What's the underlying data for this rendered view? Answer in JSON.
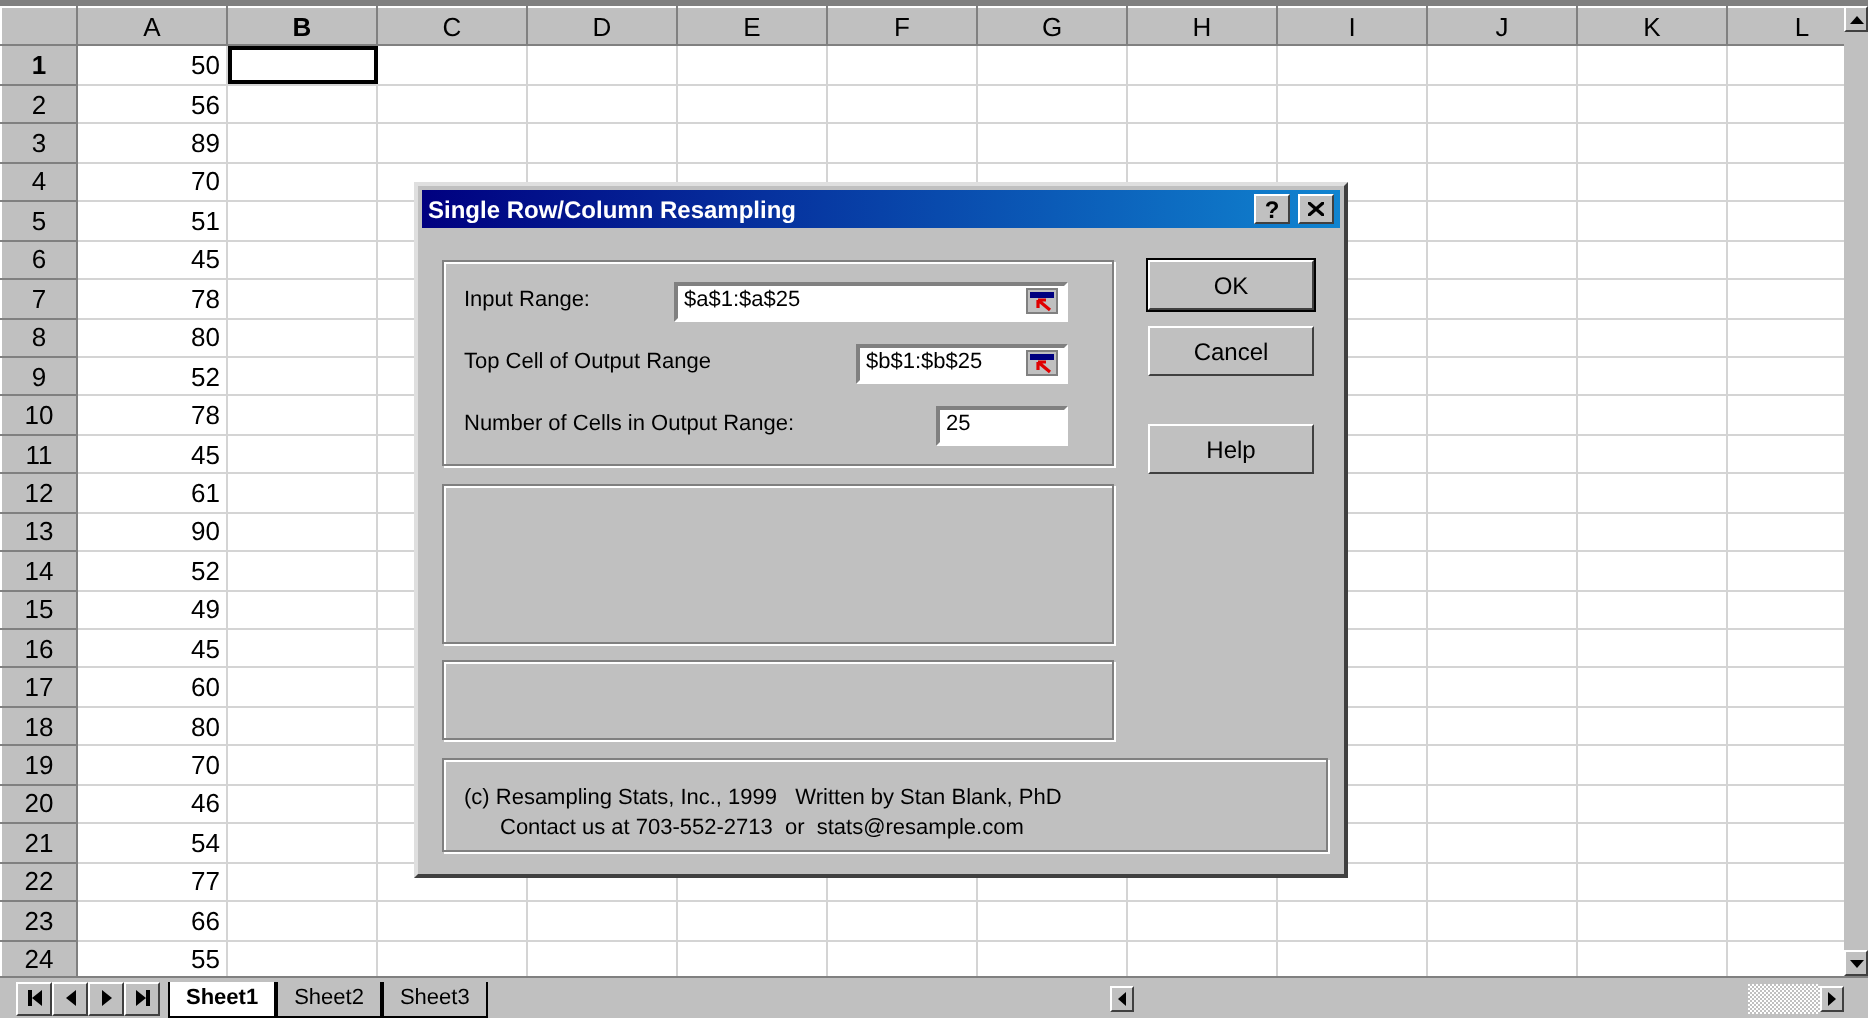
{
  "columns": [
    {
      "label": "A",
      "selected": false
    },
    {
      "label": "B",
      "selected": true
    },
    {
      "label": "C",
      "selected": false
    },
    {
      "label": "D",
      "selected": false
    },
    {
      "label": "E",
      "selected": false
    },
    {
      "label": "F",
      "selected": false
    },
    {
      "label": "G",
      "selected": false
    },
    {
      "label": "H",
      "selected": false
    },
    {
      "label": "I",
      "selected": false
    },
    {
      "label": "J",
      "selected": false
    },
    {
      "label": "K",
      "selected": false
    },
    {
      "label": "L",
      "selected": false
    }
  ],
  "rows": [
    {
      "label": "1",
      "value": "50",
      "selected": true
    },
    {
      "label": "2",
      "value": "56",
      "selected": false
    },
    {
      "label": "3",
      "value": "89",
      "selected": false
    },
    {
      "label": "4",
      "value": "70",
      "selected": false
    },
    {
      "label": "5",
      "value": "51",
      "selected": false
    },
    {
      "label": "6",
      "value": "45",
      "selected": false
    },
    {
      "label": "7",
      "value": "78",
      "selected": false
    },
    {
      "label": "8",
      "value": "80",
      "selected": false
    },
    {
      "label": "9",
      "value": "52",
      "selected": false
    },
    {
      "label": "10",
      "value": "78",
      "selected": false
    },
    {
      "label": "11",
      "value": "45",
      "selected": false
    },
    {
      "label": "12",
      "value": "61",
      "selected": false
    },
    {
      "label": "13",
      "value": "90",
      "selected": false
    },
    {
      "label": "14",
      "value": "52",
      "selected": false
    },
    {
      "label": "15",
      "value": "49",
      "selected": false
    },
    {
      "label": "16",
      "value": "45",
      "selected": false
    },
    {
      "label": "17",
      "value": "60",
      "selected": false
    },
    {
      "label": "18",
      "value": "80",
      "selected": false
    },
    {
      "label": "19",
      "value": "70",
      "selected": false
    },
    {
      "label": "20",
      "value": "46",
      "selected": false
    },
    {
      "label": "21",
      "value": "54",
      "selected": false
    },
    {
      "label": "22",
      "value": "77",
      "selected": false
    },
    {
      "label": "23",
      "value": "66",
      "selected": false
    },
    {
      "label": "24",
      "value": "55",
      "selected": false
    }
  ],
  "sheet_tabs": [
    {
      "label": "Sheet1",
      "selected": true
    },
    {
      "label": "Sheet2",
      "selected": false
    },
    {
      "label": "Sheet3",
      "selected": false
    }
  ],
  "dialog": {
    "title": "Single Row/Column Resampling",
    "help_glyph": "?",
    "fields": [
      {
        "label": "Input Range:",
        "value": "$a$1:$a$25",
        "picker": true
      },
      {
        "label": "Top Cell of Output Range",
        "value": "$b$1:$b$25",
        "picker": true
      },
      {
        "label": "Number of Cells in Output Range:",
        "value": "25",
        "picker": false
      }
    ],
    "buttons": [
      {
        "label": "OK",
        "default": true
      },
      {
        "label": "Cancel",
        "default": false
      },
      {
        "label": "Help",
        "default": false
      }
    ],
    "footer": [
      "(c) Resampling Stats, Inc., 1999   Written by Stan Blank, PhD",
      "Contact us at 703-552-2713  or  stats@resample.com"
    ]
  }
}
